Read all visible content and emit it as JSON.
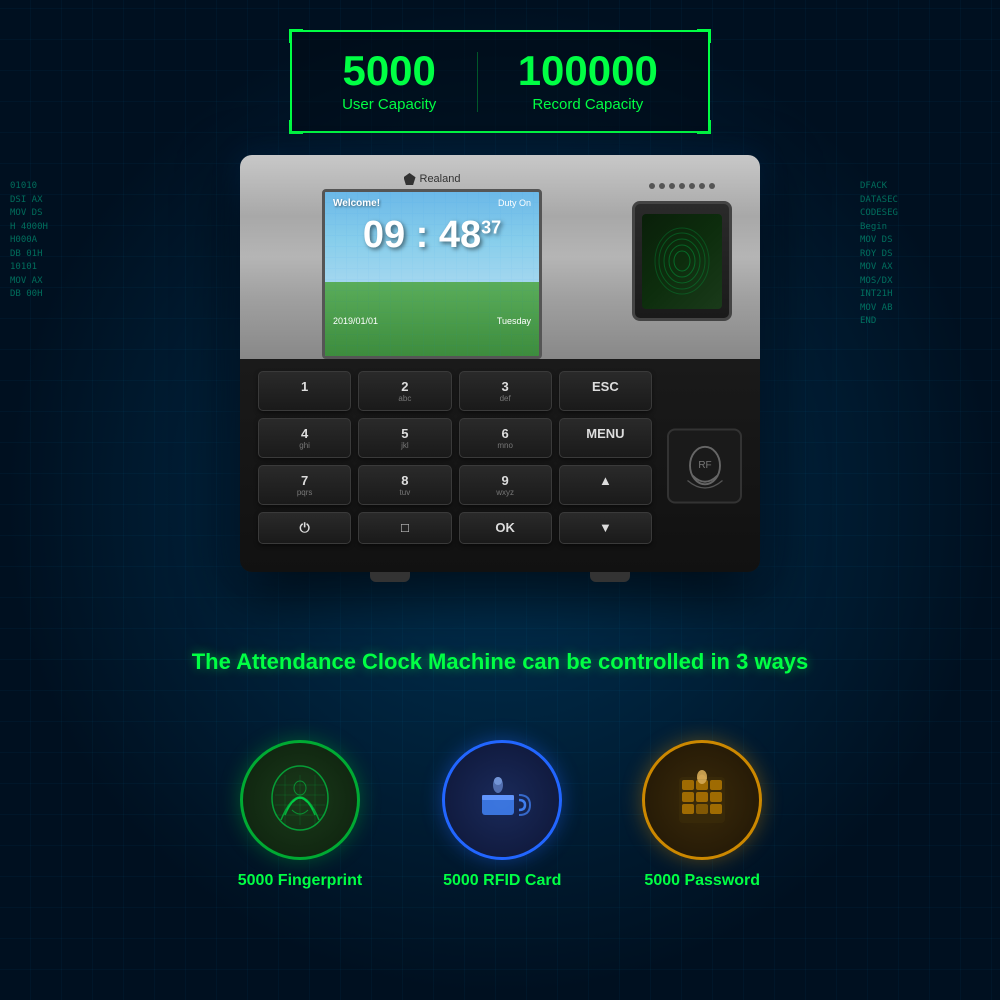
{
  "top_info": {
    "user_capacity_number": "5000",
    "user_capacity_label": "User  Capacity",
    "record_capacity_number": "100000",
    "record_capacity_label": "Record Capacity"
  },
  "device": {
    "brand": "Realand",
    "screen": {
      "welcome": "Welcome!",
      "duty": "Duty On",
      "time": "09 : 48",
      "seconds": "37",
      "date": "2019/01/01",
      "day": "Tuesday"
    },
    "keys": [
      {
        "main": "1",
        "sub": ""
      },
      {
        "main": "2",
        "sub": "abc"
      },
      {
        "main": "3",
        "sub": "def"
      },
      {
        "main": "ESC",
        "sub": ""
      },
      {
        "main": "4",
        "sub": "ghi"
      },
      {
        "main": "5",
        "sub": "jkl"
      },
      {
        "main": "6",
        "sub": "mno"
      },
      {
        "main": "MENU",
        "sub": ""
      },
      {
        "main": "7",
        "sub": "pqrs"
      },
      {
        "main": "8",
        "sub": "tuv"
      },
      {
        "main": "9",
        "sub": "wxyz"
      },
      {
        "main": "▲",
        "sub": ""
      },
      {
        "main": "⏻",
        "sub": ""
      },
      {
        "main": "□",
        "sub": ""
      },
      {
        "main": "OK",
        "sub": ""
      },
      {
        "main": "▼",
        "sub": ""
      }
    ]
  },
  "tagline": "The Attendance Clock Machine can be controlled in 3 ways",
  "features": [
    {
      "id": "fingerprint",
      "label": "5000 Fingerprint",
      "color": "green"
    },
    {
      "id": "rfid",
      "label": "5000 RFID Card",
      "color": "blue"
    },
    {
      "id": "password",
      "label": "5000 Password",
      "color": "gold"
    }
  ],
  "tech_text_left": "01010\nDSI AX\nMOV DS\nH 4000H\nH000A\nDB 01H\n10101\nMOV AX\nDB 00H",
  "tech_text_right": "DFACK\nDATASEC\nCODESEG\nBegin\nMOV DS\nROY DS\nMOV AX\nMOS/DX\nINT21H\nMOV AB\nEND"
}
